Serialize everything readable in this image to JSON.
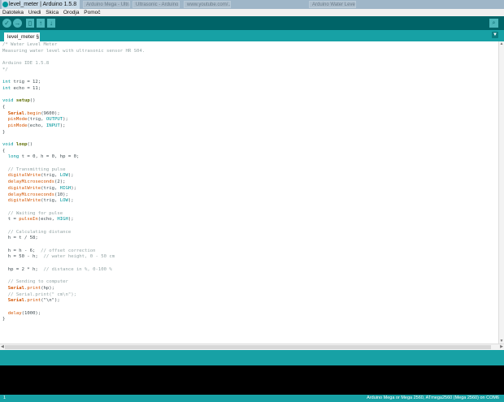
{
  "window": {
    "title": "level_meter | Arduino 1.5.8",
    "background_tabs": [
      "Arduino Mega - Ultrasonic...",
      "Ultrasonic - Arduino...",
      "www.youtube.com/...",
      "Arduino Water Level..."
    ]
  },
  "menu": [
    "Datoteka",
    "Uredi",
    "Skica",
    "Orodja",
    "Pomoč"
  ],
  "toolbar": {
    "verify": "✓",
    "upload": "→",
    "new": "▯",
    "open": "↑",
    "save": "↓",
    "serial_monitor": "⌕"
  },
  "tab": {
    "label": "level_meter §",
    "menu_glyph": "▼"
  },
  "colors": {
    "teal": "#17a1a5",
    "toolbar": "#006468",
    "comment": "#95a5a6",
    "keyword": "#00979c",
    "function": "#d35400"
  },
  "code": [
    [
      [
        "c",
        "/* Water Level Meter"
      ]
    ],
    [
      [
        "c",
        "Measuring water level with ultrasonic sensor HR S04."
      ]
    ],
    [],
    [
      [
        "c",
        "Arduino IDE 1.5.8"
      ]
    ],
    [
      [
        "c",
        "*/"
      ]
    ],
    [],
    [
      [
        "k",
        "int"
      ],
      [
        "t",
        " trig = 12;"
      ]
    ],
    [
      [
        "k",
        "int"
      ],
      [
        "t",
        " echo = 11;"
      ]
    ],
    [],
    [
      [
        "k",
        "void"
      ],
      [
        "t",
        " "
      ],
      [
        "s",
        "setup"
      ],
      [
        "t",
        "()"
      ]
    ],
    [
      [
        "t",
        "{"
      ]
    ],
    [
      [
        "t",
        "  "
      ],
      [
        "S",
        "Serial"
      ],
      [
        "t",
        "."
      ],
      [
        "f",
        "begin"
      ],
      [
        "t",
        "(9600);"
      ]
    ],
    [
      [
        "t",
        "  "
      ],
      [
        "f",
        "pinMode"
      ],
      [
        "t",
        "(trig, "
      ],
      [
        "k",
        "OUTPUT"
      ],
      [
        "t",
        ");"
      ]
    ],
    [
      [
        "t",
        "  "
      ],
      [
        "f",
        "pinMode"
      ],
      [
        "t",
        "(echo, "
      ],
      [
        "k",
        "INPUT"
      ],
      [
        "t",
        ");"
      ]
    ],
    [
      [
        "t",
        "}"
      ]
    ],
    [],
    [
      [
        "k",
        "void"
      ],
      [
        "t",
        " "
      ],
      [
        "s",
        "loop"
      ],
      [
        "t",
        "()"
      ]
    ],
    [
      [
        "t",
        "{"
      ]
    ],
    [
      [
        "t",
        "  "
      ],
      [
        "k",
        "long"
      ],
      [
        "t",
        " t = 0, h = 0, hp = 0;"
      ]
    ],
    [],
    [
      [
        "t",
        "  "
      ],
      [
        "c",
        "// Transmitting pulse"
      ]
    ],
    [
      [
        "t",
        "  "
      ],
      [
        "f",
        "digitalWrite"
      ],
      [
        "t",
        "(trig, "
      ],
      [
        "k",
        "LOW"
      ],
      [
        "t",
        ");"
      ]
    ],
    [
      [
        "t",
        "  "
      ],
      [
        "f",
        "delayMicroseconds"
      ],
      [
        "t",
        "(2);"
      ]
    ],
    [
      [
        "t",
        "  "
      ],
      [
        "f",
        "digitalWrite"
      ],
      [
        "t",
        "(trig, "
      ],
      [
        "k",
        "HIGH"
      ],
      [
        "t",
        ");"
      ]
    ],
    [
      [
        "t",
        "  "
      ],
      [
        "f",
        "delayMicroseconds"
      ],
      [
        "t",
        "(10);"
      ]
    ],
    [
      [
        "t",
        "  "
      ],
      [
        "f",
        "digitalWrite"
      ],
      [
        "t",
        "(trig, "
      ],
      [
        "k",
        "LOW"
      ],
      [
        "t",
        ");"
      ]
    ],
    [],
    [
      [
        "t",
        "  "
      ],
      [
        "c",
        "// Waiting for pulse"
      ]
    ],
    [
      [
        "t",
        "  t = "
      ],
      [
        "f",
        "pulseIn"
      ],
      [
        "t",
        "(echo, "
      ],
      [
        "k",
        "HIGH"
      ],
      [
        "t",
        ");"
      ]
    ],
    [],
    [
      [
        "t",
        "  "
      ],
      [
        "c",
        "// Calculating distance"
      ]
    ],
    [
      [
        "t",
        "  h = t / 58;"
      ]
    ],
    [],
    [
      [
        "t",
        "  h = h - 6;  "
      ],
      [
        "c",
        "// offset correction"
      ]
    ],
    [
      [
        "t",
        "  h = 50 - h;  "
      ],
      [
        "c",
        "// water height, 0 - 50 cm"
      ]
    ],
    [],
    [
      [
        "t",
        "  hp = 2 * h;  "
      ],
      [
        "c",
        "// distance in %, 0-100 %"
      ]
    ],
    [],
    [
      [
        "t",
        "  "
      ],
      [
        "c",
        "// Sending to computer"
      ]
    ],
    [
      [
        "t",
        "  "
      ],
      [
        "S",
        "Serial"
      ],
      [
        "t",
        "."
      ],
      [
        "f",
        "print"
      ],
      [
        "t",
        "(hp);"
      ]
    ],
    [
      [
        "t",
        "  "
      ],
      [
        "c",
        "// Serial.print(\" cm\\n\");"
      ]
    ],
    [
      [
        "t",
        "  "
      ],
      [
        "S",
        "Serial"
      ],
      [
        "t",
        "."
      ],
      [
        "f",
        "print"
      ],
      [
        "t",
        "(\"\\n\");"
      ]
    ],
    [],
    [
      [
        "t",
        "  "
      ],
      [
        "f",
        "delay"
      ],
      [
        "t",
        "(1000);"
      ]
    ],
    [
      [
        "t",
        "}"
      ]
    ]
  ],
  "footer": {
    "line_number": "1",
    "board": "Arduino Mega or Mega 2560, ATmega2560 (Mega 2560) on COM6"
  }
}
